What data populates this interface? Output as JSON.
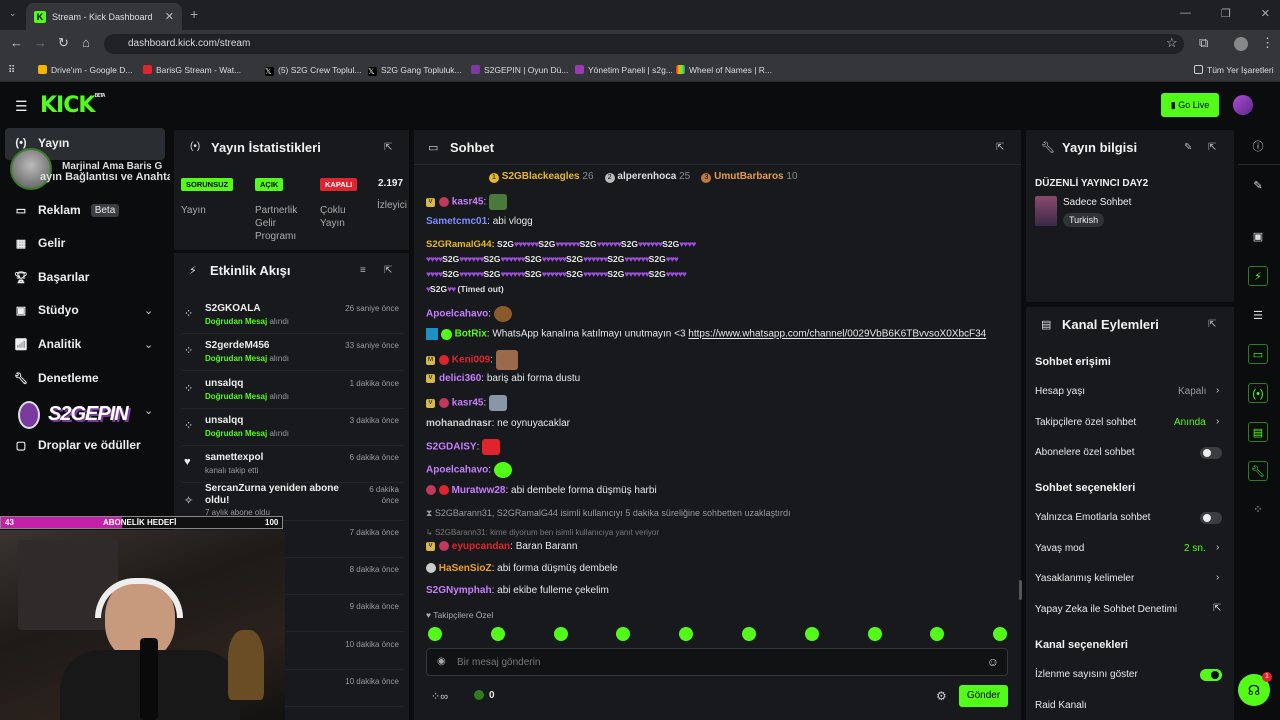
{
  "browser": {
    "tab_title": "Stream - Kick Dashboard",
    "url": "dashboard.kick.com/stream",
    "bookmarks": [
      "Drive'ım - Google D...",
      "BarisG Stream - Wat...",
      "(5) S2G Crew Toplul...",
      "S2G Gang Topluluk...",
      "S2GEPIN | Oyun Dü...",
      "Yönetim Paneli | s2g...",
      "Wheel of Names | R..."
    ],
    "bookmarks_folder": "Tüm Yer İşaretleri"
  },
  "header": {
    "logo": "KICK",
    "logo_sup": "BETA",
    "go_live": "Go Live"
  },
  "sidebar": {
    "items": [
      {
        "label": "Yayın"
      },
      {
        "label": "Reklam",
        "badge": "Beta"
      },
      {
        "label": "Gelir"
      },
      {
        "label": "Başarılar"
      },
      {
        "label": "Stüdyo"
      },
      {
        "label": "Analitik"
      },
      {
        "label": "Denetleme"
      },
      {
        "label": "Droplar ve ödüller"
      }
    ],
    "overlay_text": "Marjinal Ama Baris G",
    "overlay_text2": "ayın Bağlantısı ve Anahta",
    "overlay_logo": "S2GEPIN"
  },
  "stats": {
    "title": "Yayın İstatistikleri",
    "cards": [
      {
        "badge": "SORUNSUZ",
        "label": "Yayın",
        "color": "#53fc18"
      },
      {
        "badge": "AÇIK",
        "label": "Partnerlik Gelir Programı",
        "color": "#53fc18"
      },
      {
        "badge": "KAPALI",
        "label": "Çoklu Yayın",
        "color": "#e0242e"
      },
      {
        "badge": "2.197",
        "label": "İzleyici",
        "color": ""
      }
    ]
  },
  "activity": {
    "title": "Etkinlik Akışı",
    "events": [
      {
        "name": "S2GKOALA",
        "sub_bold": "Doğrudan Mesaj",
        "sub": " alındı",
        "time": "26 saniye önce"
      },
      {
        "name": "S2gerdeM456",
        "sub_bold": "Doğrudan Mesaj",
        "sub": " alındı",
        "time": "33 saniye önce"
      },
      {
        "name": "unsalqq",
        "sub_bold": "Doğrudan Mesaj",
        "sub": " alındı",
        "time": "1 dakika önce"
      },
      {
        "name": "unsalqq",
        "sub_bold": "Doğrudan Mesaj",
        "sub": " alındı",
        "time": "3 dakika önce"
      },
      {
        "name": "samettexpol",
        "sub_bold": "",
        "sub": "kanalı takip etti",
        "time": "6 dakika önce"
      },
      {
        "name": "SercanZurna yeniden abone oldu!",
        "sub_bold": "",
        "sub": "7 aylık abone oldu",
        "time": "6 dakika önce"
      },
      {
        "name": "",
        "sub_bold": "",
        "sub": "",
        "time": "7 dakika önce"
      },
      {
        "name": "",
        "sub_bold": "",
        "sub": "ldı",
        "time": "8 dakika önce"
      },
      {
        "name": "",
        "sub_bold": "",
        "sub": "ldı",
        "time": "9 dakika önce"
      },
      {
        "name": "",
        "sub_bold": "",
        "sub": "ldı",
        "time": "10 dakika önce"
      },
      {
        "name": "",
        "sub_bold": "",
        "sub": "ldı",
        "time": "10 dakika önce"
      }
    ]
  },
  "goal": {
    "left": "43",
    "label": "ABONELİK HEDEFİ",
    "right": "100",
    "progress": 0.43
  },
  "chat": {
    "title": "Sohbet",
    "top_gifters": [
      {
        "rank": "1",
        "name": "S2GBlackeagles",
        "count": "26"
      },
      {
        "rank": "2",
        "name": "alperenhoca",
        "count": "25"
      },
      {
        "rank": "3",
        "name": "UmutBarbaros",
        "count": "10"
      }
    ],
    "spam_user": "S2GRamalG44:",
    "spam_word": "S2G",
    "timed_out": "(Timed out)",
    "messages": [
      {
        "user": "kasr45",
        "text": "",
        "color": "#c77dff"
      },
      {
        "user": "Sametcmc01",
        "text": "abi vlogg",
        "color": "#7d8cff"
      },
      {
        "user": "Apoelcahavo",
        "text": "",
        "color": "#c77dff"
      },
      {
        "user": "BotRix",
        "text": "WhatsApp kanalına katılmayı unutmayın <3 ",
        "link": "https://www.whatsapp.com/channel/0029VbB6K6TBvvsoX0XbcF34",
        "color": "#53fc18"
      },
      {
        "user": "Keni009",
        "text": "",
        "color": "#e0242e"
      },
      {
        "user": "delici360",
        "text": "bariş abi forma dustu",
        "color": "#c77dff"
      },
      {
        "user": "kasr45",
        "text": "",
        "color": "#c77dff"
      },
      {
        "user": "mohanadnasr",
        "text": "ne oynuyacaklar",
        "color": "#cccccc"
      },
      {
        "user": "S2GDAISY",
        "text": "",
        "color": "#c77dff"
      },
      {
        "user": "Apoelcahavo",
        "text": "",
        "color": "#c77dff"
      },
      {
        "user": "Muratww28",
        "text": "abi dembele forma düşmüş harbi",
        "color": "#c77dff"
      }
    ],
    "system": "S2GBarann31, S2GRamalG44 isimli kullanıcıyı 5 dakika süreliğine sohbetten uzaklaştırdı",
    "reply_hint": "S2GBarann31: kime diyorum ben isimli kullanıcıya yanıt veriyor",
    "messages2": [
      {
        "user": "eyupcandan",
        "text": "Baran Barann",
        "color": "#e0242e"
      },
      {
        "user": "HaSenSioZ",
        "text": "abi forma düşmüş dembele",
        "color": "#f0a020"
      },
      {
        "user": "S2GNymphah",
        "text": "abi ekibe fulleme çekelim",
        "color": "#c77dff"
      }
    ],
    "followers_only": "Takipçilere Özel",
    "input_placeholder": "Bir mesaj gönderin",
    "points": "0",
    "send": "Gönder"
  },
  "info": {
    "title": "Yayın bilgisi",
    "stream_title": "DÜZENLİ YAYINCI DAY2",
    "category": "Sadece Sohbet",
    "tag": "Turkish"
  },
  "actions": {
    "title": "Kanal Eylemleri",
    "access_title": "Sohbet erişimi",
    "account_age": "Hesap yaşı",
    "account_age_val": "Kapalı",
    "followers_chat": "Takipçilere özel sohbet",
    "followers_chat_val": "Anında",
    "subs_chat": "Abonelere özel sohbet",
    "options_title": "Sohbet seçenekleri",
    "emote_only": "Yalnızca Emotlarla sohbet",
    "slow_mode": "Yavaş mod",
    "slow_mode_val": "2 sn.",
    "banned_words": "Yasaklanmış kelimeler",
    "ai_mod": "Yapay Zeka ile Sohbet Denetimi",
    "channel_title": "Kanal seçenekleri",
    "show_views": "İzlenme sayısını göster",
    "raid": "Raid Kanalı"
  }
}
